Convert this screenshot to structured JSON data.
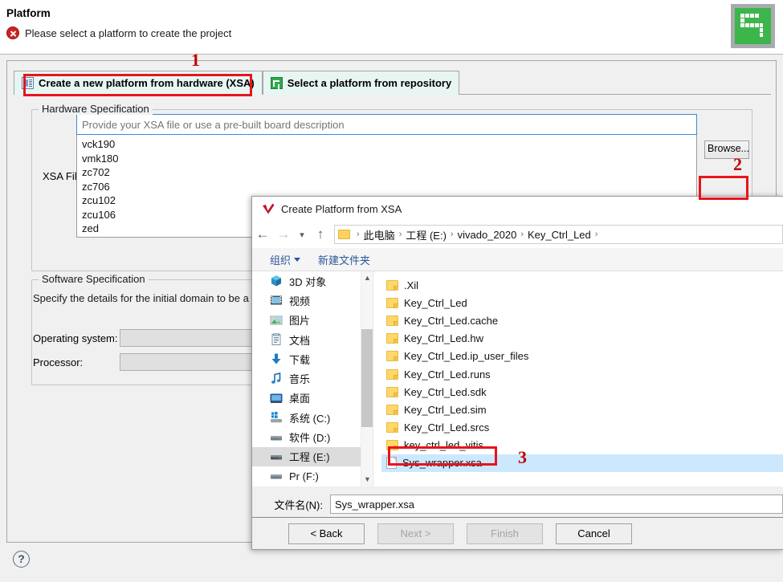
{
  "wizard": {
    "title": "Platform",
    "message": "Please select a platform to create the project",
    "error_icon": "error-circle-icon",
    "brand_icon": "vitis-green-logo",
    "tabs": [
      {
        "label": "Create a new platform from hardware (XSA)",
        "icon": "xsa-document-icon",
        "selected": true
      },
      {
        "label": "Select a platform from repository",
        "icon": "repository-green-icon",
        "selected": false
      }
    ],
    "hardware_group": {
      "legend": "Hardware Specification",
      "xsa_label": "XSA File:",
      "combo_value": "Provide your XSA file or use a pre-built board description",
      "combo_placeholder": "Provide your XSA file or use a pre-built board description",
      "list_items": [
        "vck190",
        "vmk180",
        "zc702",
        "zc706",
        "zcu102",
        "zcu106",
        "zed"
      ],
      "browse_label": "Browse..."
    },
    "software_group": {
      "legend": "Software Specification",
      "description": "Specify the details for the initial domain to be a platform.spr file",
      "os_label": "Operating system:",
      "os_value": "",
      "processor_label": "Processor:",
      "processor_value": ""
    },
    "help_label": "?"
  },
  "file_dialog": {
    "title": "Create Platform from XSA",
    "title_icon": "vitis-check-icon",
    "nav": {
      "back_icon": "arrow-left-icon",
      "forward_icon": "arrow-right-icon",
      "recent_icon": "chevron-down-icon",
      "up_icon": "arrow-up-icon",
      "breadcrumb": [
        "此电脑",
        "工程 (E:)",
        "vivado_2020",
        "Key_Ctrl_Led"
      ]
    },
    "toolbar": {
      "organize_label": "组织",
      "new_folder_label": "新建文件夹"
    },
    "nav_pane": [
      {
        "label": "3D 对象",
        "icon": "3d-object-icon",
        "selected": false
      },
      {
        "label": "视频",
        "icon": "video-icon",
        "selected": false
      },
      {
        "label": "图片",
        "icon": "pictures-icon",
        "selected": false
      },
      {
        "label": "文档",
        "icon": "documents-icon",
        "selected": false
      },
      {
        "label": "下载",
        "icon": "downloads-icon",
        "selected": false
      },
      {
        "label": "音乐",
        "icon": "music-icon",
        "selected": false
      },
      {
        "label": "桌面",
        "icon": "desktop-icon",
        "selected": false
      },
      {
        "label": "系统 (C:)",
        "icon": "windows-drive-icon",
        "selected": false
      },
      {
        "label": "软件 (D:)",
        "icon": "drive-icon",
        "selected": false
      },
      {
        "label": "工程 (E:)",
        "icon": "drive-icon",
        "selected": true
      },
      {
        "label": "Pr (F:)",
        "icon": "drive-icon",
        "selected": false
      }
    ],
    "files": [
      {
        "name": ".Xil",
        "type": "folder",
        "selected": false
      },
      {
        "name": "Key_Ctrl_Led",
        "type": "folder",
        "selected": false
      },
      {
        "name": "Key_Ctrl_Led.cache",
        "type": "folder",
        "selected": false
      },
      {
        "name": "Key_Ctrl_Led.hw",
        "type": "folder",
        "selected": false
      },
      {
        "name": "Key_Ctrl_Led.ip_user_files",
        "type": "folder",
        "selected": false
      },
      {
        "name": "Key_Ctrl_Led.runs",
        "type": "folder",
        "selected": false
      },
      {
        "name": "Key_Ctrl_Led.sdk",
        "type": "folder",
        "selected": false
      },
      {
        "name": "Key_Ctrl_Led.sim",
        "type": "folder",
        "selected": false
      },
      {
        "name": "Key_Ctrl_Led.srcs",
        "type": "folder",
        "selected": false
      },
      {
        "name": "key_ctrl_led_vitis",
        "type": "folder",
        "selected": false
      },
      {
        "name": "Sys_wrapper.xsa",
        "type": "file",
        "selected": true
      }
    ],
    "filename": {
      "label": "文件名(N):",
      "value": "Sys_wrapper.xsa"
    },
    "buttons": [
      {
        "label": "< Back",
        "enabled": true
      },
      {
        "label": "Next >",
        "enabled": false
      },
      {
        "label": "Finish",
        "enabled": false
      },
      {
        "label": "Cancel",
        "enabled": true
      }
    ]
  },
  "annotations": [
    {
      "number": "1",
      "target": "create-new-platform-tab"
    },
    {
      "number": "2",
      "target": "browse-button"
    },
    {
      "number": "3",
      "target": "sys-wrapper-xsa-file-row"
    }
  ],
  "colors": {
    "annotation_red": "#e8141d",
    "annotation_number": "#c00000",
    "brand_green": "#3cb54a",
    "selection_blue": "#cce8ff",
    "focus_border": "#3b8ad9"
  }
}
